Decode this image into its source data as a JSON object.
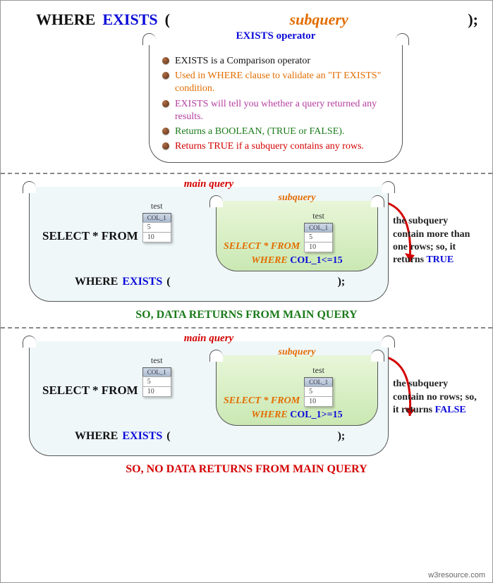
{
  "syntax": {
    "where": "WHERE",
    "exists": "EXISTS",
    "open": "(",
    "subquery": "subquery",
    "close": ");"
  },
  "operator_box": {
    "title": "EXISTS operator",
    "bullets": [
      {
        "text": "EXISTS is a Comparison operator",
        "color": "#111"
      },
      {
        "text": "Used in WHERE clause to validate an \"IT EXISTS\" condition.",
        "color": "#e26d00"
      },
      {
        "text": "EXISTS will tell you whether a query returned any results.",
        "color": "#b43da0"
      },
      {
        "text": "Returns a BOOLEAN, (TRUE or FALSE).",
        "color": "#1a7a1a"
      },
      {
        "text": "Returns TRUE if a subquery contains any rows.",
        "color": "#d40000"
      }
    ]
  },
  "example_true": {
    "main_label": "main query",
    "sub_label": "subquery",
    "table_name": "test",
    "col_header": "COL_1",
    "rows": [
      "5",
      "10"
    ],
    "select": "SELECT * FROM",
    "where": "WHERE",
    "exists": "EXISTS",
    "open": "(",
    "close": ");",
    "sub_select": "SELECT * FROM",
    "sub_where": "WHERE",
    "sub_cond": "COL_1<=15",
    "side": "the subquery contain more than one rows; so, it returns TRUE",
    "result": "SO, DATA RETURNS FROM MAIN QUERY"
  },
  "example_false": {
    "main_label": "main query",
    "sub_label": "subquery",
    "table_name": "test",
    "col_header": "COL_1",
    "rows": [
      "5",
      "10"
    ],
    "select": "SELECT * FROM",
    "where": "WHERE",
    "exists": "EXISTS",
    "open": "(",
    "close": ");",
    "sub_select": "SELECT * FROM",
    "sub_where": "WHERE",
    "sub_cond": "COL_1>=15",
    "side": "the subquery contain no rows; so, it returns FALSE",
    "result": "SO, NO DATA RETURNS FROM MAIN QUERY"
  },
  "footer": "w3resource.com"
}
